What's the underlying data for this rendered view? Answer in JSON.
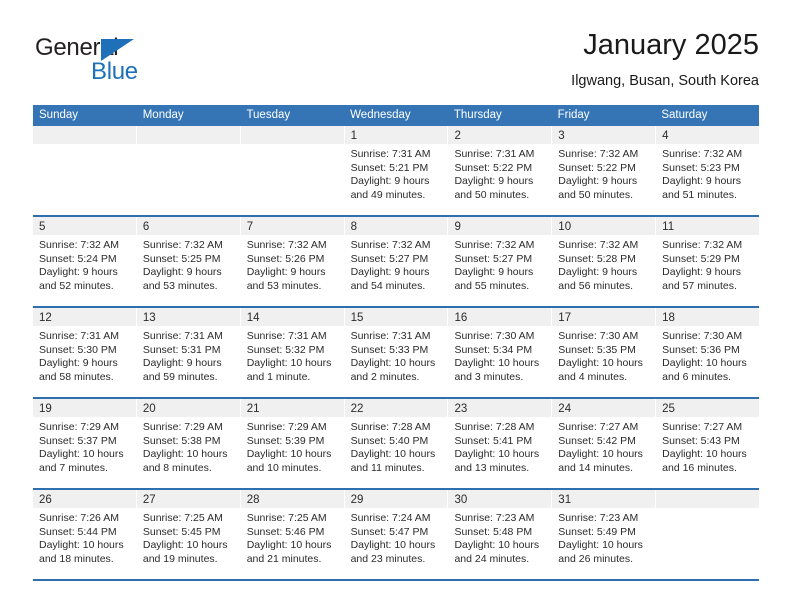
{
  "brand": {
    "name_top": "General",
    "name_bottom": "Blue",
    "triangle_icon": "blue-triangle-icon",
    "accent_color": "#1e71b8"
  },
  "header": {
    "title": "January 2025",
    "subtitle": "Ilgwang, Busan, South Korea"
  },
  "calendar": {
    "header_bg": "#3575b6",
    "row_divider_color": "#2f6fae",
    "daynum_strip_bg": "#f0f0f0",
    "weekdays": [
      "Sunday",
      "Monday",
      "Tuesday",
      "Wednesday",
      "Thursday",
      "Friday",
      "Saturday"
    ],
    "weeks": [
      [
        {
          "day": "",
          "sunrise": "",
          "sunset": "",
          "daylight1": "",
          "daylight2": ""
        },
        {
          "day": "",
          "sunrise": "",
          "sunset": "",
          "daylight1": "",
          "daylight2": ""
        },
        {
          "day": "",
          "sunrise": "",
          "sunset": "",
          "daylight1": "",
          "daylight2": ""
        },
        {
          "day": "1",
          "sunrise": "Sunrise: 7:31 AM",
          "sunset": "Sunset: 5:21 PM",
          "daylight1": "Daylight: 9 hours",
          "daylight2": "and 49 minutes."
        },
        {
          "day": "2",
          "sunrise": "Sunrise: 7:31 AM",
          "sunset": "Sunset: 5:22 PM",
          "daylight1": "Daylight: 9 hours",
          "daylight2": "and 50 minutes."
        },
        {
          "day": "3",
          "sunrise": "Sunrise: 7:32 AM",
          "sunset": "Sunset: 5:22 PM",
          "daylight1": "Daylight: 9 hours",
          "daylight2": "and 50 minutes."
        },
        {
          "day": "4",
          "sunrise": "Sunrise: 7:32 AM",
          "sunset": "Sunset: 5:23 PM",
          "daylight1": "Daylight: 9 hours",
          "daylight2": "and 51 minutes."
        }
      ],
      [
        {
          "day": "5",
          "sunrise": "Sunrise: 7:32 AM",
          "sunset": "Sunset: 5:24 PM",
          "daylight1": "Daylight: 9 hours",
          "daylight2": "and 52 minutes."
        },
        {
          "day": "6",
          "sunrise": "Sunrise: 7:32 AM",
          "sunset": "Sunset: 5:25 PM",
          "daylight1": "Daylight: 9 hours",
          "daylight2": "and 53 minutes."
        },
        {
          "day": "7",
          "sunrise": "Sunrise: 7:32 AM",
          "sunset": "Sunset: 5:26 PM",
          "daylight1": "Daylight: 9 hours",
          "daylight2": "and 53 minutes."
        },
        {
          "day": "8",
          "sunrise": "Sunrise: 7:32 AM",
          "sunset": "Sunset: 5:27 PM",
          "daylight1": "Daylight: 9 hours",
          "daylight2": "and 54 minutes."
        },
        {
          "day": "9",
          "sunrise": "Sunrise: 7:32 AM",
          "sunset": "Sunset: 5:27 PM",
          "daylight1": "Daylight: 9 hours",
          "daylight2": "and 55 minutes."
        },
        {
          "day": "10",
          "sunrise": "Sunrise: 7:32 AM",
          "sunset": "Sunset: 5:28 PM",
          "daylight1": "Daylight: 9 hours",
          "daylight2": "and 56 minutes."
        },
        {
          "day": "11",
          "sunrise": "Sunrise: 7:32 AM",
          "sunset": "Sunset: 5:29 PM",
          "daylight1": "Daylight: 9 hours",
          "daylight2": "and 57 minutes."
        }
      ],
      [
        {
          "day": "12",
          "sunrise": "Sunrise: 7:31 AM",
          "sunset": "Sunset: 5:30 PM",
          "daylight1": "Daylight: 9 hours",
          "daylight2": "and 58 minutes."
        },
        {
          "day": "13",
          "sunrise": "Sunrise: 7:31 AM",
          "sunset": "Sunset: 5:31 PM",
          "daylight1": "Daylight: 9 hours",
          "daylight2": "and 59 minutes."
        },
        {
          "day": "14",
          "sunrise": "Sunrise: 7:31 AM",
          "sunset": "Sunset: 5:32 PM",
          "daylight1": "Daylight: 10 hours",
          "daylight2": "and 1 minute."
        },
        {
          "day": "15",
          "sunrise": "Sunrise: 7:31 AM",
          "sunset": "Sunset: 5:33 PM",
          "daylight1": "Daylight: 10 hours",
          "daylight2": "and 2 minutes."
        },
        {
          "day": "16",
          "sunrise": "Sunrise: 7:30 AM",
          "sunset": "Sunset: 5:34 PM",
          "daylight1": "Daylight: 10 hours",
          "daylight2": "and 3 minutes."
        },
        {
          "day": "17",
          "sunrise": "Sunrise: 7:30 AM",
          "sunset": "Sunset: 5:35 PM",
          "daylight1": "Daylight: 10 hours",
          "daylight2": "and 4 minutes."
        },
        {
          "day": "18",
          "sunrise": "Sunrise: 7:30 AM",
          "sunset": "Sunset: 5:36 PM",
          "daylight1": "Daylight: 10 hours",
          "daylight2": "and 6 minutes."
        }
      ],
      [
        {
          "day": "19",
          "sunrise": "Sunrise: 7:29 AM",
          "sunset": "Sunset: 5:37 PM",
          "daylight1": "Daylight: 10 hours",
          "daylight2": "and 7 minutes."
        },
        {
          "day": "20",
          "sunrise": "Sunrise: 7:29 AM",
          "sunset": "Sunset: 5:38 PM",
          "daylight1": "Daylight: 10 hours",
          "daylight2": "and 8 minutes."
        },
        {
          "day": "21",
          "sunrise": "Sunrise: 7:29 AM",
          "sunset": "Sunset: 5:39 PM",
          "daylight1": "Daylight: 10 hours",
          "daylight2": "and 10 minutes."
        },
        {
          "day": "22",
          "sunrise": "Sunrise: 7:28 AM",
          "sunset": "Sunset: 5:40 PM",
          "daylight1": "Daylight: 10 hours",
          "daylight2": "and 11 minutes."
        },
        {
          "day": "23",
          "sunrise": "Sunrise: 7:28 AM",
          "sunset": "Sunset: 5:41 PM",
          "daylight1": "Daylight: 10 hours",
          "daylight2": "and 13 minutes."
        },
        {
          "day": "24",
          "sunrise": "Sunrise: 7:27 AM",
          "sunset": "Sunset: 5:42 PM",
          "daylight1": "Daylight: 10 hours",
          "daylight2": "and 14 minutes."
        },
        {
          "day": "25",
          "sunrise": "Sunrise: 7:27 AM",
          "sunset": "Sunset: 5:43 PM",
          "daylight1": "Daylight: 10 hours",
          "daylight2": "and 16 minutes."
        }
      ],
      [
        {
          "day": "26",
          "sunrise": "Sunrise: 7:26 AM",
          "sunset": "Sunset: 5:44 PM",
          "daylight1": "Daylight: 10 hours",
          "daylight2": "and 18 minutes."
        },
        {
          "day": "27",
          "sunrise": "Sunrise: 7:25 AM",
          "sunset": "Sunset: 5:45 PM",
          "daylight1": "Daylight: 10 hours",
          "daylight2": "and 19 minutes."
        },
        {
          "day": "28",
          "sunrise": "Sunrise: 7:25 AM",
          "sunset": "Sunset: 5:46 PM",
          "daylight1": "Daylight: 10 hours",
          "daylight2": "and 21 minutes."
        },
        {
          "day": "29",
          "sunrise": "Sunrise: 7:24 AM",
          "sunset": "Sunset: 5:47 PM",
          "daylight1": "Daylight: 10 hours",
          "daylight2": "and 23 minutes."
        },
        {
          "day": "30",
          "sunrise": "Sunrise: 7:23 AM",
          "sunset": "Sunset: 5:48 PM",
          "daylight1": "Daylight: 10 hours",
          "daylight2": "and 24 minutes."
        },
        {
          "day": "31",
          "sunrise": "Sunrise: 7:23 AM",
          "sunset": "Sunset: 5:49 PM",
          "daylight1": "Daylight: 10 hours",
          "daylight2": "and 26 minutes."
        },
        {
          "day": "",
          "sunrise": "",
          "sunset": "",
          "daylight1": "",
          "daylight2": ""
        }
      ]
    ]
  }
}
